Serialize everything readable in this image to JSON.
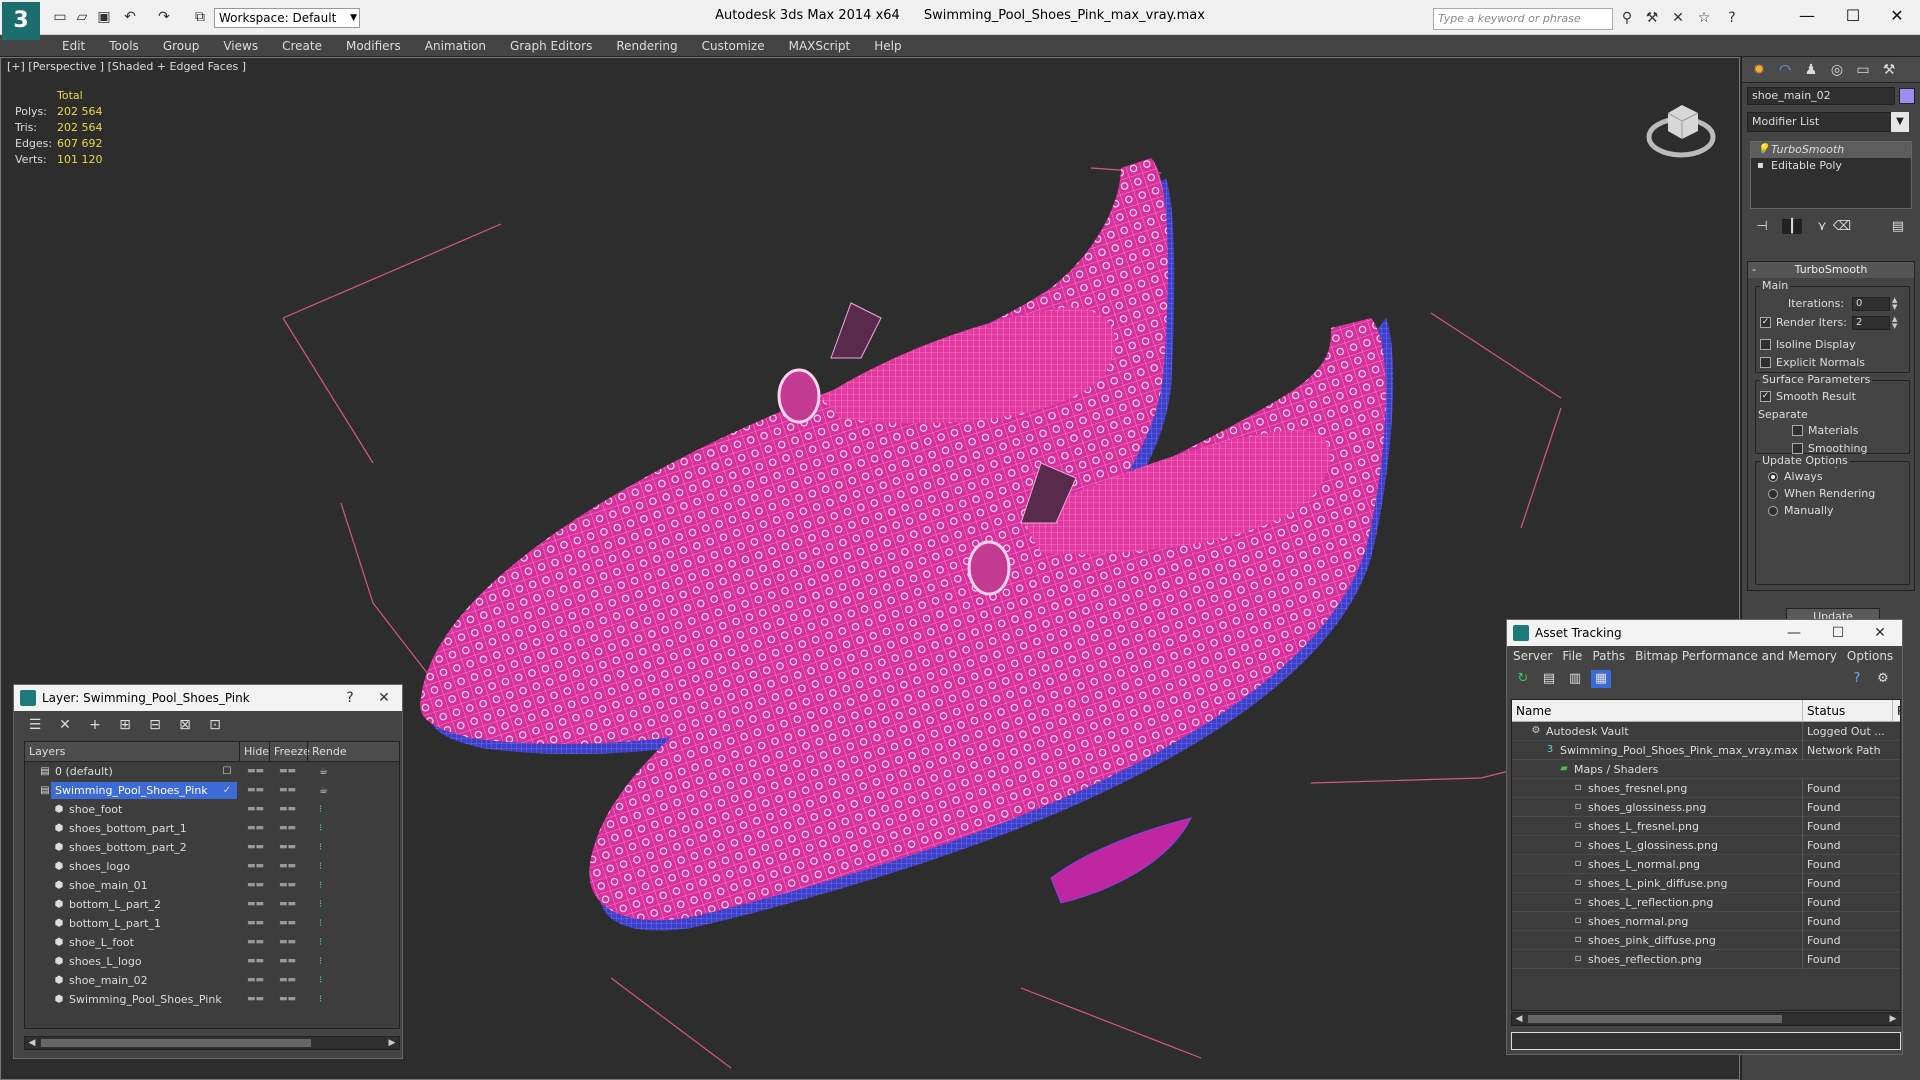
{
  "app": {
    "title": "Autodesk 3ds Max  2014 x64",
    "file": "Swimming_Pool_Shoes_Pink_max_vray.max",
    "workspace": "Workspace: Default",
    "search_placeholder": "Type a keyword or phrase"
  },
  "menu": [
    "Edit",
    "Tools",
    "Group",
    "Views",
    "Create",
    "Modifiers",
    "Animation",
    "Graph Editors",
    "Rendering",
    "Customize",
    "MAXScript",
    "Help"
  ],
  "viewport": {
    "label": "[+] [Perspective ] [Shaded + Edged Faces ]",
    "stats": {
      "header": "Total",
      "rows": [
        {
          "label": "Polys:",
          "value": "202 564"
        },
        {
          "label": "Tris:",
          "value": "202 564"
        },
        {
          "label": "Edges:",
          "value": "607 692"
        },
        {
          "label": "Verts:",
          "value": "101 120"
        }
      ]
    },
    "colors": {
      "wire": "#e33aa8",
      "sole": "#4a4fd8",
      "grid": "#e15c8c"
    }
  },
  "command_panel": {
    "object_name": "shoe_main_02",
    "object_color": "#9a8ef2",
    "modifier_list": "Modifier List",
    "stack": [
      {
        "label": "TurboSmooth",
        "selected": true
      },
      {
        "label": "Editable Poly",
        "selected": false
      }
    ],
    "turbosmooth": {
      "title": "TurboSmooth",
      "main_label": "Main",
      "iterations_label": "Iterations:",
      "iterations": "0",
      "render_iters_label": "Render Iters:",
      "render_iters": "2",
      "isoline_label": "Isoline Display",
      "explicit_label": "Explicit Normals",
      "surface_label": "Surface Parameters",
      "smooth_result_label": "Smooth Result",
      "separate_label": "Separate",
      "materials_label": "Materials",
      "smoothing_label": "Smoothing Groups",
      "update_options_label": "Update Options",
      "always_label": "Always",
      "when_rendering_label": "When Rendering",
      "manually_label": "Manually",
      "update_button": "Update"
    }
  },
  "layer_dialog": {
    "title": "Layer: Swimming_Pool_Shoes_Pink",
    "help": "?",
    "columns": [
      "Layers",
      "Hide",
      "Freeze",
      "Rende"
    ],
    "rows": [
      {
        "name": "0 (default)",
        "level": 0,
        "selected": false
      },
      {
        "name": "Swimming_Pool_Shoes_Pink",
        "level": 0,
        "selected": true
      },
      {
        "name": "shoe_foot",
        "level": 1,
        "selected": false
      },
      {
        "name": "shoes_bottom_part_1",
        "level": 1,
        "selected": false
      },
      {
        "name": "shoes_bottom_part_2",
        "level": 1,
        "selected": false
      },
      {
        "name": "shoes_logo",
        "level": 1,
        "selected": false
      },
      {
        "name": "shoe_main_01",
        "level": 1,
        "selected": false
      },
      {
        "name": "bottom_L_part_2",
        "level": 1,
        "selected": false
      },
      {
        "name": "bottom_L_part_1",
        "level": 1,
        "selected": false
      },
      {
        "name": "shoe_L_foot",
        "level": 1,
        "selected": false
      },
      {
        "name": "shoes_L_logo",
        "level": 1,
        "selected": false
      },
      {
        "name": "shoe_main_02",
        "level": 1,
        "selected": false
      },
      {
        "name": "Swimming_Pool_Shoes_Pink",
        "level": 1,
        "selected": false
      }
    ]
  },
  "asset_dialog": {
    "title": "Asset Tracking",
    "menu": [
      "Server",
      "File",
      "Paths",
      "Bitmap Performance and Memory",
      "Options"
    ],
    "columns": [
      "Name",
      "Status",
      "P"
    ],
    "rows": [
      {
        "name": "Autodesk Vault",
        "status": "Logged Out ...",
        "level": 0
      },
      {
        "name": "Swimming_Pool_Shoes_Pink_max_vray.max",
        "status": "Network Path",
        "level": 1
      },
      {
        "name": "Maps / Shaders",
        "status": "",
        "level": 2
      },
      {
        "name": "shoes_fresnel.png",
        "status": "Found",
        "level": 3
      },
      {
        "name": "shoes_glossiness.png",
        "status": "Found",
        "level": 3
      },
      {
        "name": "shoes_L_fresnel.png",
        "status": "Found",
        "level": 3
      },
      {
        "name": "shoes_L_glossiness.png",
        "status": "Found",
        "level": 3
      },
      {
        "name": "shoes_L_normal.png",
        "status": "Found",
        "level": 3
      },
      {
        "name": "shoes_L_pink_diffuse.png",
        "status": "Found",
        "level": 3
      },
      {
        "name": "shoes_L_reflection.png",
        "status": "Found",
        "level": 3
      },
      {
        "name": "shoes_normal.png",
        "status": "Found",
        "level": 3
      },
      {
        "name": "shoes_pink_diffuse.png",
        "status": "Found",
        "level": 3
      },
      {
        "name": "shoes_reflection.png",
        "status": "Found",
        "level": 3
      }
    ]
  }
}
